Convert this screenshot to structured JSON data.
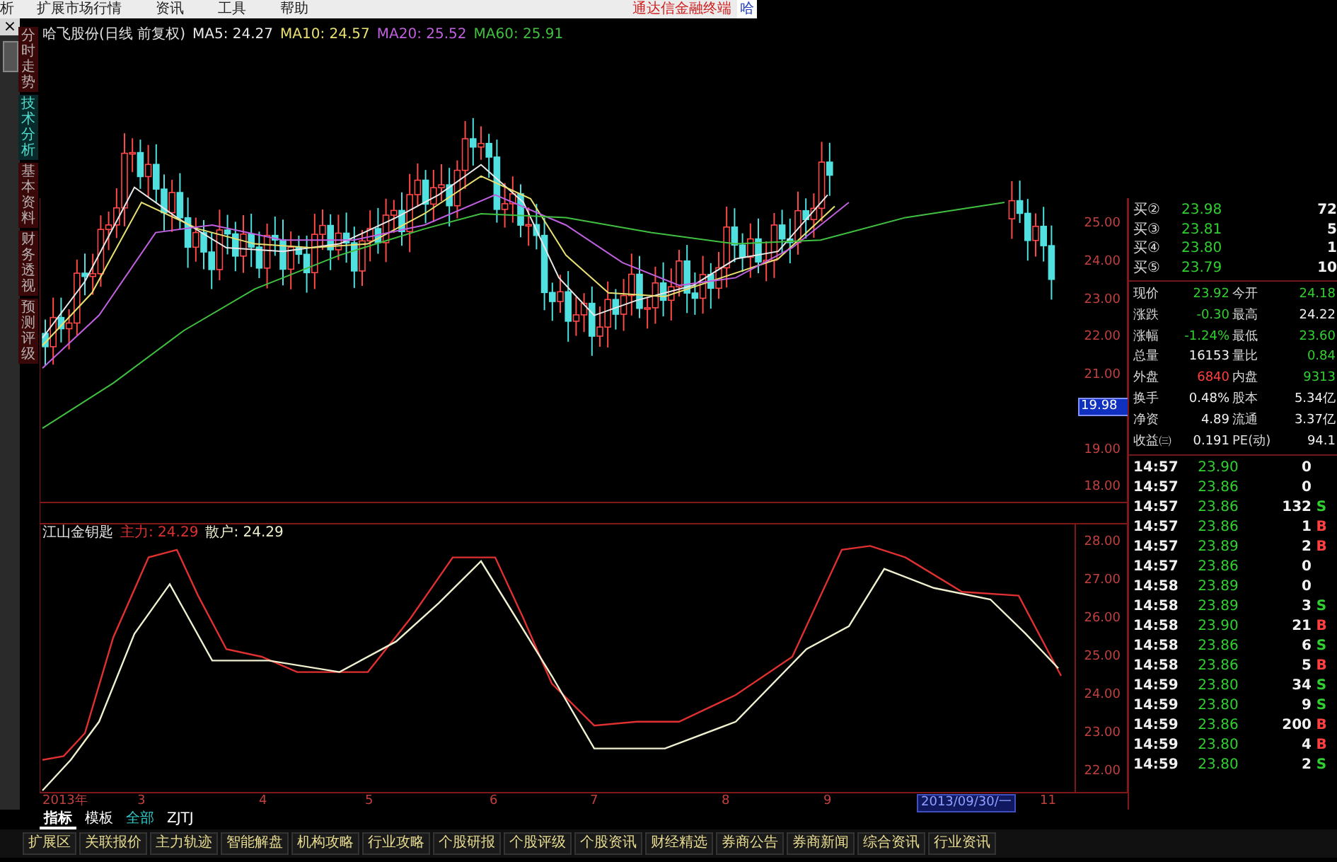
{
  "menu": {
    "cut_item": "析",
    "items": [
      "扩展市场行情",
      "资讯",
      "工具",
      "帮助"
    ],
    "brand": "通达信金融终端",
    "brand_cut": "哈"
  },
  "side_tabs": [
    {
      "label": "分时走势",
      "selected": false
    },
    {
      "label": "技术分析",
      "selected": true
    },
    {
      "label": "基本资料",
      "selected": false
    },
    {
      "label": "财务透视",
      "selected": false
    },
    {
      "label": "预测评级",
      "selected": false
    }
  ],
  "close_symbol": "×",
  "chart": {
    "title": "哈飞股份(日线 前复权)",
    "ma": [
      {
        "label": "MA5: 24.27",
        "color": "#e8e8e8"
      },
      {
        "label": "MA10: 24.57",
        "color": "#e8e070"
      },
      {
        "label": "MA20: 25.52",
        "color": "#c060e0"
      },
      {
        "label": "MA60: 25.91",
        "color": "#40c040"
      }
    ],
    "price_axis": [
      {
        "label": "25.00",
        "kind": "tick"
      },
      {
        "label": "24.00",
        "kind": "tick"
      },
      {
        "label": "23.00",
        "kind": "tick"
      },
      {
        "label": "22.00",
        "kind": "tick"
      },
      {
        "label": "21.00",
        "kind": "tick"
      },
      {
        "label": "19.98",
        "kind": "cursor"
      },
      {
        "label": "19.00",
        "kind": "tick"
      },
      {
        "label": "18.00",
        "kind": "tick"
      }
    ],
    "indicator": {
      "name": "江山金钥匙",
      "series": [
        {
          "label": "主力: 24.29",
          "color": "#e03030"
        },
        {
          "label": "散户: 24.29",
          "color": "#f0f0d0"
        }
      ],
      "axis": [
        "28.00",
        "27.00",
        "26.00",
        "25.00",
        "24.00",
        "23.00",
        "22.00"
      ]
    },
    "time_axis": [
      {
        "label": "2013年",
        "kind": "tick"
      },
      {
        "label": "3",
        "kind": "tick"
      },
      {
        "label": "4",
        "kind": "tick"
      },
      {
        "label": "5",
        "kind": "tick"
      },
      {
        "label": "6",
        "kind": "tick"
      },
      {
        "label": "7",
        "kind": "tick"
      },
      {
        "label": "8",
        "kind": "tick"
      },
      {
        "label": "9",
        "kind": "tick"
      },
      {
        "label": "2013/09/30/一",
        "kind": "cursor"
      },
      {
        "label": "11",
        "kind": "tick"
      }
    ]
  },
  "quote": {
    "bids": [
      {
        "label": "买②",
        "price": "23.98",
        "volume": "72"
      },
      {
        "label": "买③",
        "price": "23.81",
        "volume": "5"
      },
      {
        "label": "买④",
        "price": "23.80",
        "volume": "1"
      },
      {
        "label": "买⑤",
        "price": "23.79",
        "volume": "10"
      }
    ],
    "stats": [
      {
        "label": "现价",
        "value": "23.92",
        "color": "#30d030"
      },
      {
        "label": "今开",
        "value": "24.18",
        "color": "#30d030"
      },
      {
        "label": "涨跌",
        "value": "-0.30",
        "color": "#30d030"
      },
      {
        "label": "最高",
        "value": "24.22",
        "color": "#f0f0f0"
      },
      {
        "label": "涨幅",
        "value": "-1.24%",
        "color": "#30d030"
      },
      {
        "label": "最低",
        "value": "23.60",
        "color": "#30d030"
      },
      {
        "label": "总量",
        "value": "16153",
        "color": "#f0f0f0"
      },
      {
        "label": "量比",
        "value": "0.84",
        "color": "#30d030"
      },
      {
        "label": "外盘",
        "value": "6840",
        "color": "#ff4040"
      },
      {
        "label": "内盘",
        "value": "9313",
        "color": "#30d030"
      },
      {
        "label": "换手",
        "value": "0.48%",
        "color": "#f0f0f0"
      },
      {
        "label": "股本",
        "value": "5.34亿",
        "color": "#f0f0f0"
      },
      {
        "label": "净资",
        "value": "4.89",
        "color": "#f0f0f0"
      },
      {
        "label": "流通",
        "value": "3.37亿",
        "color": "#f0f0f0"
      },
      {
        "label": "收益㈢",
        "value": "0.191",
        "color": "#f0f0f0"
      },
      {
        "label": "PE(动)",
        "value": "94.1",
        "color": "#f0f0f0"
      }
    ],
    "ticks": [
      {
        "time": "14:57",
        "price": "23.90",
        "volume": "0"
      },
      {
        "time": "14:57",
        "price": "23.86",
        "volume": "0"
      },
      {
        "time": "14:57",
        "price": "23.86",
        "volume": "132",
        "side": "S"
      },
      {
        "time": "14:57",
        "price": "23.86",
        "volume": "1",
        "side": "B"
      },
      {
        "time": "14:57",
        "price": "23.89",
        "volume": "2",
        "side": "B"
      },
      {
        "time": "14:57",
        "price": "23.86",
        "volume": "0"
      },
      {
        "time": "14:58",
        "price": "23.89",
        "volume": "0"
      },
      {
        "time": "14:58",
        "price": "23.89",
        "volume": "3",
        "side": "S"
      },
      {
        "time": "14:58",
        "price": "23.90",
        "volume": "21",
        "side": "B"
      },
      {
        "time": "14:58",
        "price": "23.86",
        "volume": "6",
        "side": "S"
      },
      {
        "time": "14:58",
        "price": "23.86",
        "volume": "5",
        "side": "B"
      },
      {
        "time": "14:59",
        "price": "23.80",
        "volume": "34",
        "side": "S"
      },
      {
        "time": "14:59",
        "price": "23.80",
        "volume": "9",
        "side": "S"
      },
      {
        "time": "14:59",
        "price": "23.86",
        "volume": "200",
        "side": "B"
      },
      {
        "time": "14:59",
        "price": "23.80",
        "volume": "4",
        "side": "B"
      },
      {
        "time": "14:59",
        "price": "23.80",
        "volume": "2",
        "side": "S"
      }
    ]
  },
  "bottom_tabs": [
    {
      "label": "指标",
      "selected": true,
      "color": "#ffffff"
    },
    {
      "label": "模板",
      "selected": false,
      "color": "#ffffff"
    },
    {
      "label": "全部",
      "selected": false,
      "color": "#30c8c8"
    },
    {
      "label": "ZJTJ",
      "selected": false,
      "color": "#ffffff"
    }
  ],
  "bottom_buttons": [
    "扩展区",
    "关联报价",
    "主力轨迹",
    "智能解盘",
    "机构攻略",
    "行业攻略",
    "个股研报",
    "个股评级",
    "个股资讯",
    "财经精选",
    "券商公告",
    "券商新闻",
    "综合资讯",
    "行业资讯"
  ]
}
